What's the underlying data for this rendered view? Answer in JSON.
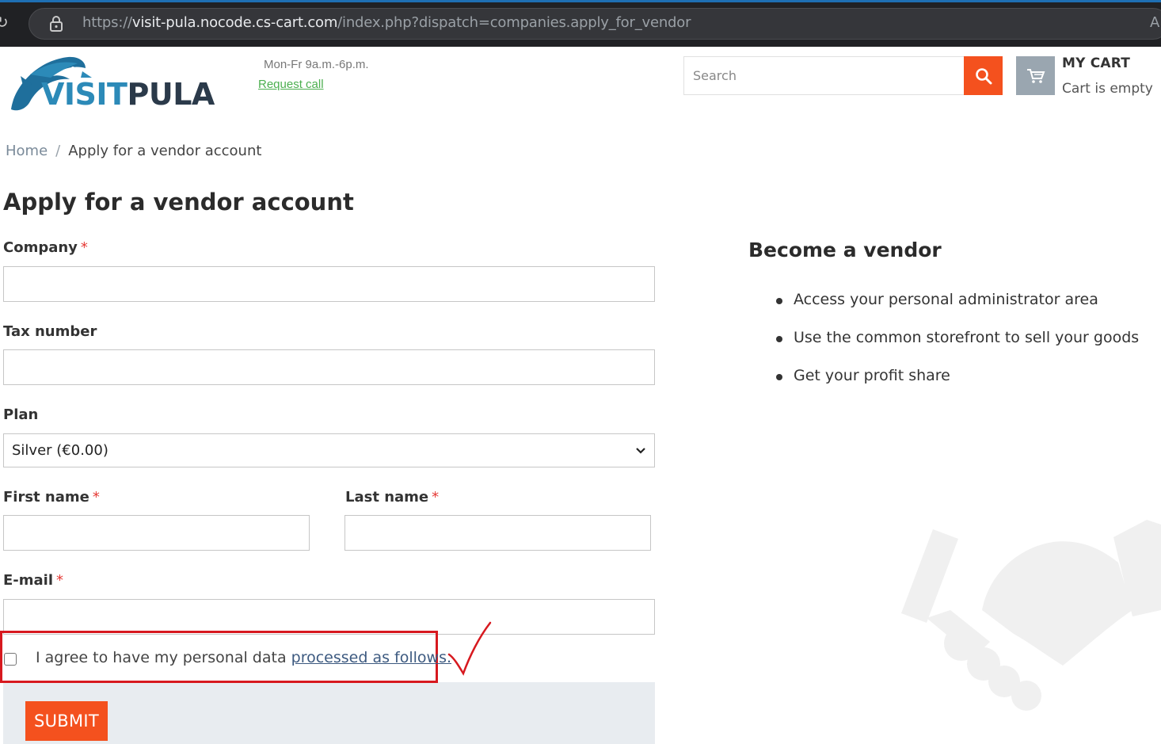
{
  "browser": {
    "url_scheme": "https://",
    "url_host": "visit-pula.nocode.cs-cart.com",
    "url_path": "/index.php?dispatch=companies.apply_for_vendor",
    "right_glyph": "A"
  },
  "header": {
    "logo_visit": "VISIT",
    "logo_pula": "PULA",
    "hours": "Mon-Fr 9a.m.-6p.m.",
    "request_call": "Request call",
    "search_placeholder": "Search",
    "cart_title": "MY CART",
    "cart_status": "Cart is empty"
  },
  "breadcrumb": {
    "home": "Home",
    "separator": "/",
    "current": "Apply for a vendor account"
  },
  "page_title": "Apply for a vendor account",
  "form": {
    "required_mark": "*",
    "company_label": "Company",
    "tax_label": "Tax number",
    "plan_label": "Plan",
    "plan_value": "Silver (€0.00)",
    "first_name_label": "First name",
    "last_name_label": "Last name",
    "email_label": "E-mail",
    "consent_prefix": "I agree to have my personal data ",
    "consent_link": "processed as follows.",
    "submit_label": "SUBMIT"
  },
  "sidebar": {
    "title": "Become a vendor",
    "benefits": [
      "Access your personal administrator area",
      "Use the common storefront to sell your goods",
      "Get your profit share"
    ]
  },
  "colors": {
    "accent": "#f4511e",
    "annotation_red": "#d7191f",
    "link_green": "#4caf50"
  }
}
